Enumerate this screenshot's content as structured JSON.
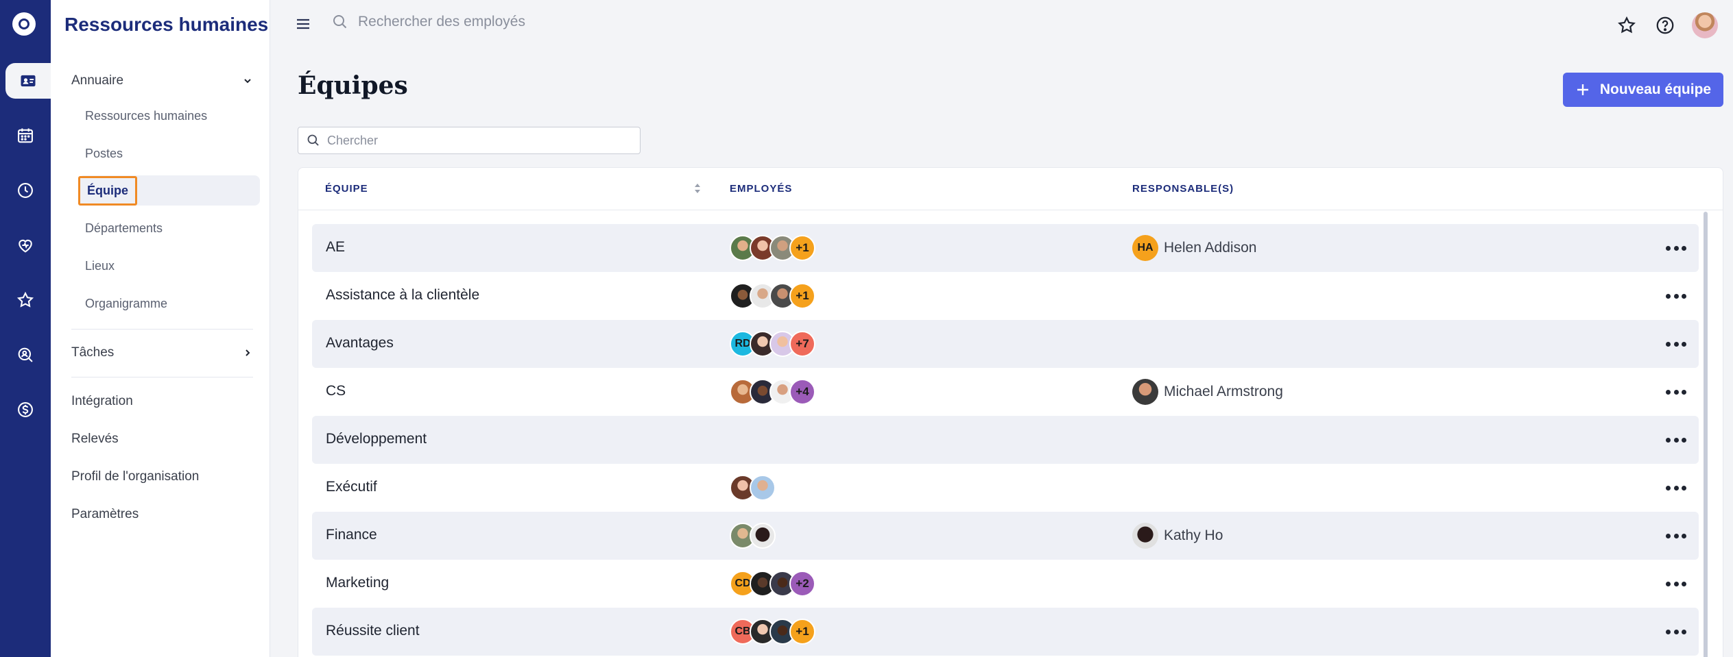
{
  "app": {
    "title": "Ressources humaines"
  },
  "topbar": {
    "search_placeholder": "Rechercher des employés"
  },
  "sidebar": {
    "sections": [
      {
        "label": "Annuaire"
      },
      {
        "label": "Tâches"
      }
    ],
    "subitems": [
      {
        "label": "Ressources humaines"
      },
      {
        "label": "Postes"
      },
      {
        "label": "Équipe"
      },
      {
        "label": "Départements"
      },
      {
        "label": "Lieux"
      },
      {
        "label": "Organigramme"
      }
    ],
    "links": [
      {
        "label": "Intégration"
      },
      {
        "label": "Relevés"
      },
      {
        "label": "Profil de l'organisation"
      },
      {
        "label": "Paramètres"
      }
    ]
  },
  "page": {
    "title": "Équipes",
    "new_button": "Nouveau équipe",
    "search_placeholder": "Chercher"
  },
  "table": {
    "headers": {
      "team": "ÉQUIPE",
      "employees": "EMPLOYÉS",
      "managers": "RESPONSABLE(S)"
    },
    "rows": [
      {
        "name": "AE",
        "more": "+1",
        "manager_initials": "HA",
        "manager": "Helen Addison"
      },
      {
        "name": "Assistance à la clientèle",
        "more": "+1",
        "manager": ""
      },
      {
        "name": "Avantages",
        "first_initials": "RD",
        "more": "+7",
        "manager": ""
      },
      {
        "name": "CS",
        "more": "+4",
        "manager": "Michael Armstrong"
      },
      {
        "name": "Développement",
        "manager": ""
      },
      {
        "name": "Exécutif",
        "manager": ""
      },
      {
        "name": "Finance",
        "manager": "Kathy Ho"
      },
      {
        "name": "Marketing",
        "first_initials": "CD",
        "more": "+2",
        "manager": ""
      },
      {
        "name": "Réussite client",
        "first_initials": "CB",
        "more": "+1",
        "manager": ""
      }
    ]
  },
  "colors": {
    "brand": "#1c2c7a",
    "accent": "#5465e8",
    "highlight": "#f08a24",
    "badge_orange": "#f5a11c",
    "badge_red": "#ef6a5a",
    "badge_purple": "#9b5bb8",
    "badge_cyan": "#1cb8e0"
  }
}
